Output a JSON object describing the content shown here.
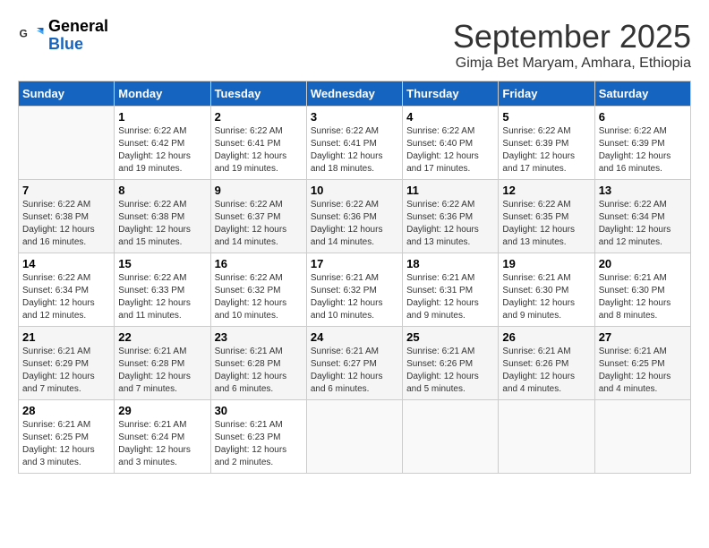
{
  "logo": {
    "general": "General",
    "blue": "Blue"
  },
  "header": {
    "month_title": "September 2025",
    "subtitle": "Gimja Bet Maryam, Amhara, Ethiopia"
  },
  "weekdays": [
    "Sunday",
    "Monday",
    "Tuesday",
    "Wednesday",
    "Thursday",
    "Friday",
    "Saturday"
  ],
  "weeks": [
    [
      {
        "day": "",
        "info": ""
      },
      {
        "day": "1",
        "info": "Sunrise: 6:22 AM\nSunset: 6:42 PM\nDaylight: 12 hours\nand 19 minutes."
      },
      {
        "day": "2",
        "info": "Sunrise: 6:22 AM\nSunset: 6:41 PM\nDaylight: 12 hours\nand 19 minutes."
      },
      {
        "day": "3",
        "info": "Sunrise: 6:22 AM\nSunset: 6:41 PM\nDaylight: 12 hours\nand 18 minutes."
      },
      {
        "day": "4",
        "info": "Sunrise: 6:22 AM\nSunset: 6:40 PM\nDaylight: 12 hours\nand 17 minutes."
      },
      {
        "day": "5",
        "info": "Sunrise: 6:22 AM\nSunset: 6:39 PM\nDaylight: 12 hours\nand 17 minutes."
      },
      {
        "day": "6",
        "info": "Sunrise: 6:22 AM\nSunset: 6:39 PM\nDaylight: 12 hours\nand 16 minutes."
      }
    ],
    [
      {
        "day": "7",
        "info": "Sunrise: 6:22 AM\nSunset: 6:38 PM\nDaylight: 12 hours\nand 16 minutes."
      },
      {
        "day": "8",
        "info": "Sunrise: 6:22 AM\nSunset: 6:38 PM\nDaylight: 12 hours\nand 15 minutes."
      },
      {
        "day": "9",
        "info": "Sunrise: 6:22 AM\nSunset: 6:37 PM\nDaylight: 12 hours\nand 14 minutes."
      },
      {
        "day": "10",
        "info": "Sunrise: 6:22 AM\nSunset: 6:36 PM\nDaylight: 12 hours\nand 14 minutes."
      },
      {
        "day": "11",
        "info": "Sunrise: 6:22 AM\nSunset: 6:36 PM\nDaylight: 12 hours\nand 13 minutes."
      },
      {
        "day": "12",
        "info": "Sunrise: 6:22 AM\nSunset: 6:35 PM\nDaylight: 12 hours\nand 13 minutes."
      },
      {
        "day": "13",
        "info": "Sunrise: 6:22 AM\nSunset: 6:34 PM\nDaylight: 12 hours\nand 12 minutes."
      }
    ],
    [
      {
        "day": "14",
        "info": "Sunrise: 6:22 AM\nSunset: 6:34 PM\nDaylight: 12 hours\nand 12 minutes."
      },
      {
        "day": "15",
        "info": "Sunrise: 6:22 AM\nSunset: 6:33 PM\nDaylight: 12 hours\nand 11 minutes."
      },
      {
        "day": "16",
        "info": "Sunrise: 6:22 AM\nSunset: 6:32 PM\nDaylight: 12 hours\nand 10 minutes."
      },
      {
        "day": "17",
        "info": "Sunrise: 6:21 AM\nSunset: 6:32 PM\nDaylight: 12 hours\nand 10 minutes."
      },
      {
        "day": "18",
        "info": "Sunrise: 6:21 AM\nSunset: 6:31 PM\nDaylight: 12 hours\nand 9 minutes."
      },
      {
        "day": "19",
        "info": "Sunrise: 6:21 AM\nSunset: 6:30 PM\nDaylight: 12 hours\nand 9 minutes."
      },
      {
        "day": "20",
        "info": "Sunrise: 6:21 AM\nSunset: 6:30 PM\nDaylight: 12 hours\nand 8 minutes."
      }
    ],
    [
      {
        "day": "21",
        "info": "Sunrise: 6:21 AM\nSunset: 6:29 PM\nDaylight: 12 hours\nand 7 minutes."
      },
      {
        "day": "22",
        "info": "Sunrise: 6:21 AM\nSunset: 6:28 PM\nDaylight: 12 hours\nand 7 minutes."
      },
      {
        "day": "23",
        "info": "Sunrise: 6:21 AM\nSunset: 6:28 PM\nDaylight: 12 hours\nand 6 minutes."
      },
      {
        "day": "24",
        "info": "Sunrise: 6:21 AM\nSunset: 6:27 PM\nDaylight: 12 hours\nand 6 minutes."
      },
      {
        "day": "25",
        "info": "Sunrise: 6:21 AM\nSunset: 6:26 PM\nDaylight: 12 hours\nand 5 minutes."
      },
      {
        "day": "26",
        "info": "Sunrise: 6:21 AM\nSunset: 6:26 PM\nDaylight: 12 hours\nand 4 minutes."
      },
      {
        "day": "27",
        "info": "Sunrise: 6:21 AM\nSunset: 6:25 PM\nDaylight: 12 hours\nand 4 minutes."
      }
    ],
    [
      {
        "day": "28",
        "info": "Sunrise: 6:21 AM\nSunset: 6:25 PM\nDaylight: 12 hours\nand 3 minutes."
      },
      {
        "day": "29",
        "info": "Sunrise: 6:21 AM\nSunset: 6:24 PM\nDaylight: 12 hours\nand 3 minutes."
      },
      {
        "day": "30",
        "info": "Sunrise: 6:21 AM\nSunset: 6:23 PM\nDaylight: 12 hours\nand 2 minutes."
      },
      {
        "day": "",
        "info": ""
      },
      {
        "day": "",
        "info": ""
      },
      {
        "day": "",
        "info": ""
      },
      {
        "day": "",
        "info": ""
      }
    ]
  ]
}
